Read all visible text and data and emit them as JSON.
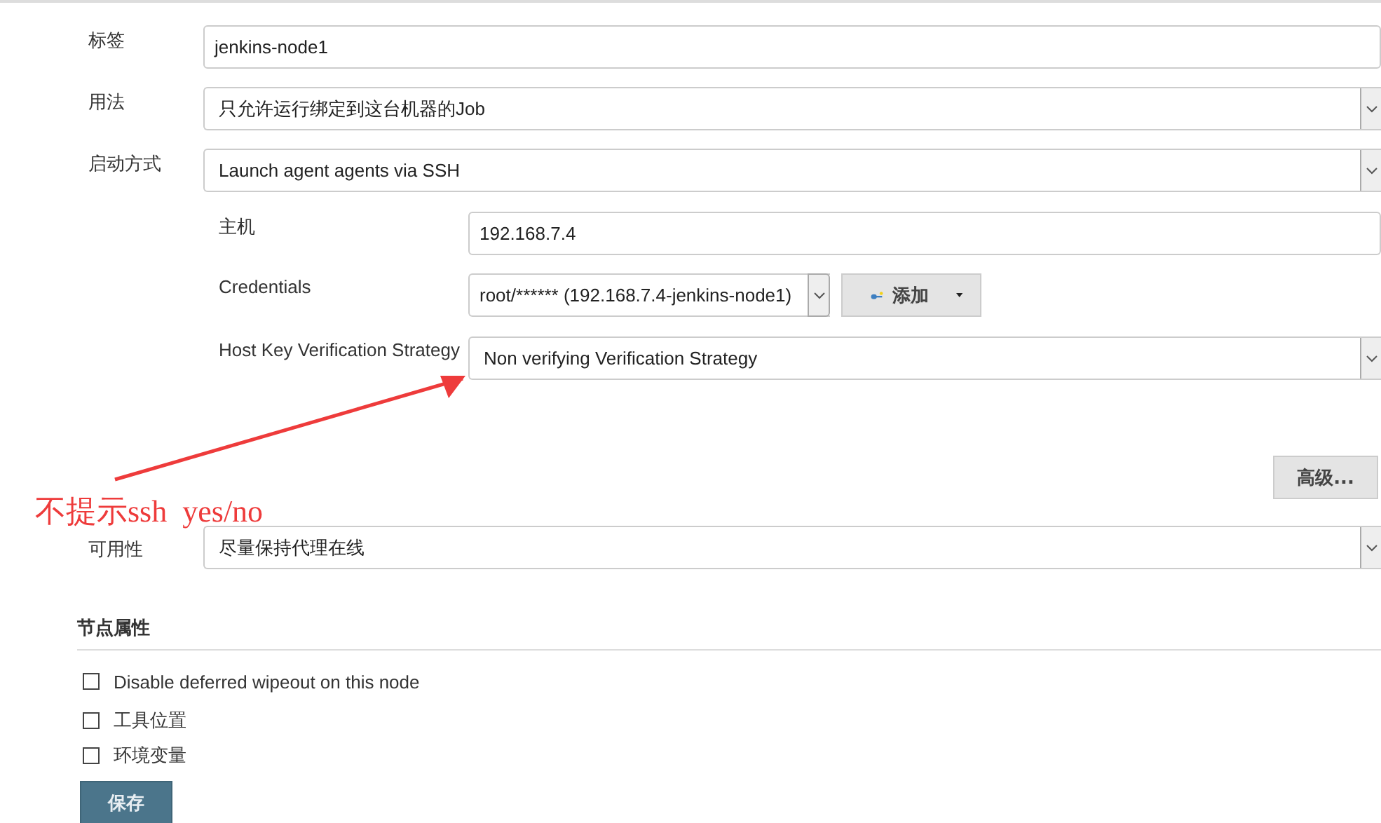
{
  "fields": [
    {
      "label": "标签",
      "kind": "text",
      "value": "jenkins-node1"
    },
    {
      "label": "用法",
      "kind": "select",
      "value": "只允许运行绑定到这台机器的Job"
    },
    {
      "label": "启动方式",
      "kind": "select",
      "value": "Launch agent agents via SSH"
    }
  ],
  "launch_options": [
    {
      "label": "主机",
      "kind": "text",
      "value": "192.168.7.4"
    },
    {
      "label": "Credentials",
      "kind": "credentials",
      "value": "root/****** (192.168.7.4-jenkins-node1)",
      "add_button": "添加"
    },
    {
      "label": "Host Key Verification Strategy",
      "kind": "select",
      "value": "Non verifying Verification Strategy"
    }
  ],
  "advanced_button": "高级...",
  "availability": {
    "label": "可用性",
    "value": "尽量保持代理在线"
  },
  "node_properties": {
    "title": "节点属性",
    "options": [
      {
        "label": "Disable deferred wipeout on this node",
        "checked": false
      },
      {
        "label": "工具位置",
        "checked": false
      },
      {
        "label": "环境变量",
        "checked": false
      }
    ]
  },
  "save_button": "保存",
  "annotation": {
    "text": "不提示ssh  yes/no"
  }
}
